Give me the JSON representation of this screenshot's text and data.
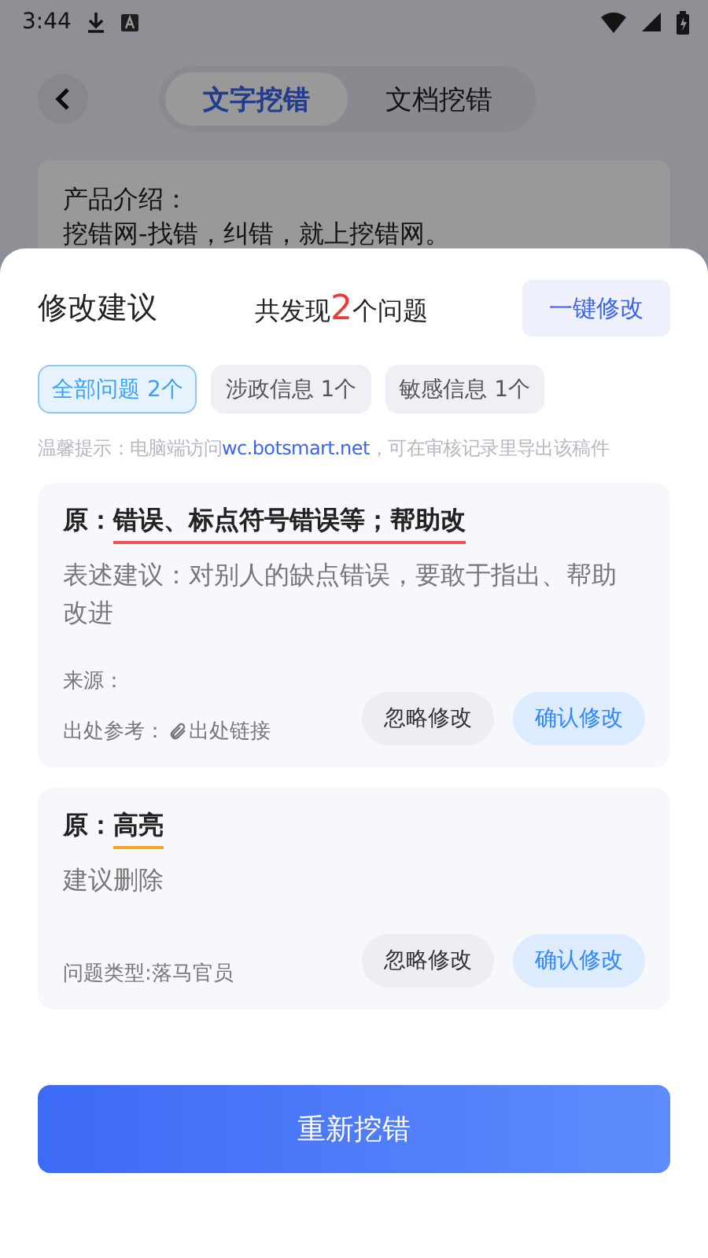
{
  "status_bar": {
    "time": "3:44"
  },
  "tabs": [
    {
      "label": "文字挖错",
      "selected": true
    },
    {
      "label": "文档挖错",
      "selected": false
    }
  ],
  "input_text": [
    "产品介绍：",
    "挖错网-找错，纠错，就上挖错网。"
  ],
  "sheet": {
    "title": "修改建议",
    "summary": {
      "prefix": "共发现",
      "count": "2",
      "suffix": "个问题"
    },
    "fix_all_button": "一键修改",
    "filters": [
      {
        "label": "全部问题 2个",
        "selected": true
      },
      {
        "label": "涉政信息 1个",
        "selected": false
      },
      {
        "label": "敏感信息 1个",
        "selected": false
      }
    ],
    "hint": {
      "before": "温馨提示：电脑端访问",
      "link": "wc.botsmart.net",
      "after": "，可在审核记录里导出该稿件"
    },
    "issues": [
      {
        "kind": "source",
        "original_label": "原：",
        "original": "错误、标点符号错误等；帮助改",
        "color": "#f0525a",
        "suggestion": "表述建议：对别人的缺点错误，要敢于指出、帮助改进",
        "source_label": "来源：",
        "reference_label": "出处参考：",
        "reference_link": "出处链接",
        "ignore": "忽略修改",
        "confirm": "确认修改"
      },
      {
        "kind": "type",
        "original_label": "原：",
        "original": "高亮",
        "color": "#f5a623",
        "suggestion": "建议删除",
        "type": "问题类型:落马官员",
        "ignore": "忽略修改",
        "confirm": "确认修改"
      }
    ],
    "recheck_button": "重新挖错"
  }
}
